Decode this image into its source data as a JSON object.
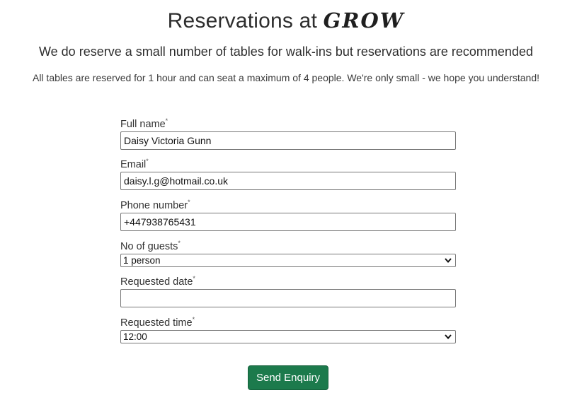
{
  "header": {
    "title_prefix": "Reservations at ",
    "brand": "GROW",
    "subtitle": "We do reserve a small number of tables for walk-ins but reservations are recommended",
    "note": "All tables are reserved for 1 hour and can seat a maximum of 4 people. We're only small - we hope you understand!"
  },
  "form": {
    "required_mark": "*",
    "full_name": {
      "label": "Full name",
      "value": "Daisy Victoria Gunn"
    },
    "email": {
      "label": "Email",
      "value": "daisy.l.g@hotmail.co.uk"
    },
    "phone": {
      "label": "Phone number",
      "value": "+447938765431"
    },
    "guests": {
      "label": "No of guests",
      "selected": "1 person"
    },
    "date": {
      "label": "Requested date",
      "value": ""
    },
    "time": {
      "label": "Requested time",
      "selected": "12:00"
    },
    "submit_label": "Send Enquiry"
  },
  "colors": {
    "button_bg": "#1c7a4c",
    "button_text": "#ffffff"
  },
  "icons": {
    "select_arrow": "chevron-down-icon"
  }
}
